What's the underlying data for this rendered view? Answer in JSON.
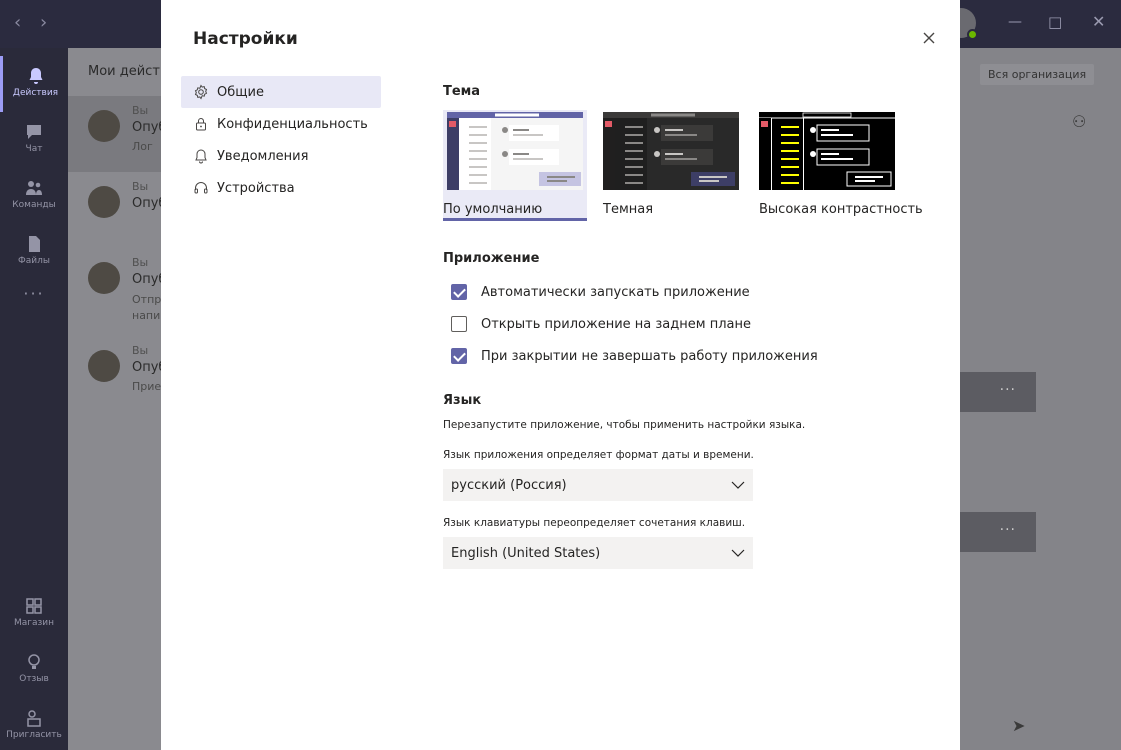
{
  "background": {
    "rail": [
      {
        "label": "Действия",
        "icon": "bell-icon",
        "active": true
      },
      {
        "label": "Чат",
        "icon": "chat-icon"
      },
      {
        "label": "Команды",
        "icon": "teams-icon"
      },
      {
        "label": "Файлы",
        "icon": "file-icon"
      },
      {
        "label": "Магазин",
        "icon": "store-icon"
      },
      {
        "label": "Отзыв",
        "icon": "lightbulb-icon"
      },
      {
        "label": "Пригласить",
        "icon": "invite-icon"
      }
    ],
    "more_label": "···",
    "list_header": "Мои действ",
    "rows": [
      {
        "who": "Вы",
        "title": "Опуб",
        "sub": "Лог"
      },
      {
        "who": "Вы",
        "title": "Опуб",
        "sub": ""
      },
      {
        "who": "Вы",
        "title": "Опуб",
        "sub": "Отпр\nнапи"
      },
      {
        "who": "Вы",
        "title": "Опуб",
        "sub": "Прие"
      }
    ],
    "org_filter": "Вся организация",
    "card_dots": "···"
  },
  "dialog": {
    "title": "Настройки",
    "nav": [
      {
        "label": "Общие",
        "icon": "gear-icon",
        "active": true
      },
      {
        "label": "Конфиденциальность",
        "icon": "lock-icon"
      },
      {
        "label": "Уведомления",
        "icon": "bell-icon"
      },
      {
        "label": "Устройства",
        "icon": "headset-icon"
      }
    ],
    "theme": {
      "heading": "Тема",
      "options": [
        {
          "label": "По умолчанию",
          "selected": true
        },
        {
          "label": "Темная",
          "selected": false
        },
        {
          "label": "Высокая контрастность",
          "selected": false
        }
      ]
    },
    "app": {
      "heading": "Приложение",
      "options": [
        {
          "label": "Автоматически запускать приложение",
          "checked": true
        },
        {
          "label": "Открыть приложение на заднем плане",
          "checked": false
        },
        {
          "label": "При закрытии не завершать работу приложения",
          "checked": true
        }
      ]
    },
    "language": {
      "heading": "Язык",
      "restart_hint": "Перезапустите приложение, чтобы применить настройки языка.",
      "app_lang_hint": "Язык приложения определяет формат даты и времени.",
      "app_lang_value": "русский (Россия)",
      "kbd_lang_hint": "Язык клавиатуры переопределяет сочетания клавиш.",
      "kbd_lang_value": "English (United States)"
    }
  },
  "colors": {
    "accent": "#6264a7",
    "nav_active_bg": "#e8e8f6",
    "select_bg": "#f3f2f1"
  }
}
